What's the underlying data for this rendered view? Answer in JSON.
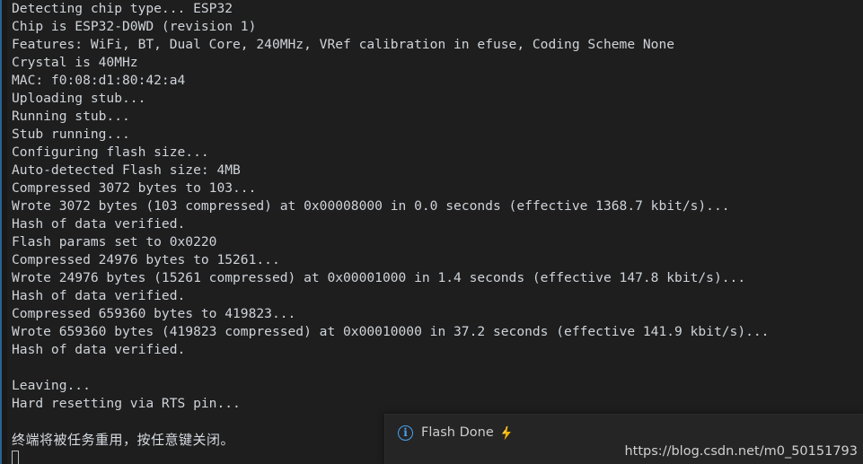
{
  "terminal": {
    "background_color": "#1e1e1e",
    "text_color": "#cfd4da",
    "accent_color": "#2b6ea8",
    "lines": [
      "Detecting chip type... ESP32",
      "Chip is ESP32-D0WD (revision 1)",
      "Features: WiFi, BT, Dual Core, 240MHz, VRef calibration in efuse, Coding Scheme None",
      "Crystal is 40MHz",
      "MAC: f0:08:d1:80:42:a4",
      "Uploading stub...",
      "Running stub...",
      "Stub running...",
      "Configuring flash size...",
      "Auto-detected Flash size: 4MB",
      "Compressed 3072 bytes to 103...",
      "Wrote 3072 bytes (103 compressed) at 0x00008000 in 0.0 seconds (effective 1368.7 kbit/s)...",
      "Hash of data verified.",
      "Flash params set to 0x0220",
      "Compressed 24976 bytes to 15261...",
      "Wrote 24976 bytes (15261 compressed) at 0x00001000 in 1.4 seconds (effective 147.8 kbit/s)...",
      "Hash of data verified.",
      "Compressed 659360 bytes to 419823...",
      "Wrote 659360 bytes (419823 compressed) at 0x00010000 in 37.2 seconds (effective 141.9 kbit/s)...",
      "Hash of data verified.",
      "",
      "Leaving...",
      "Hard resetting via RTS pin...",
      ""
    ],
    "closing_message": "终端将被任务重用，按任意键关闭。"
  },
  "notification": {
    "icon": "info-circle-icon",
    "icon_glyph": "i",
    "icon_color": "#4aa3f0",
    "message": "Flash Done",
    "status_icon": "lightning-bolt-icon",
    "status_icon_color": "#f2b705",
    "background_color": "#252526"
  },
  "watermark": {
    "text": "https://blog.csdn.net/m0_50151793"
  }
}
